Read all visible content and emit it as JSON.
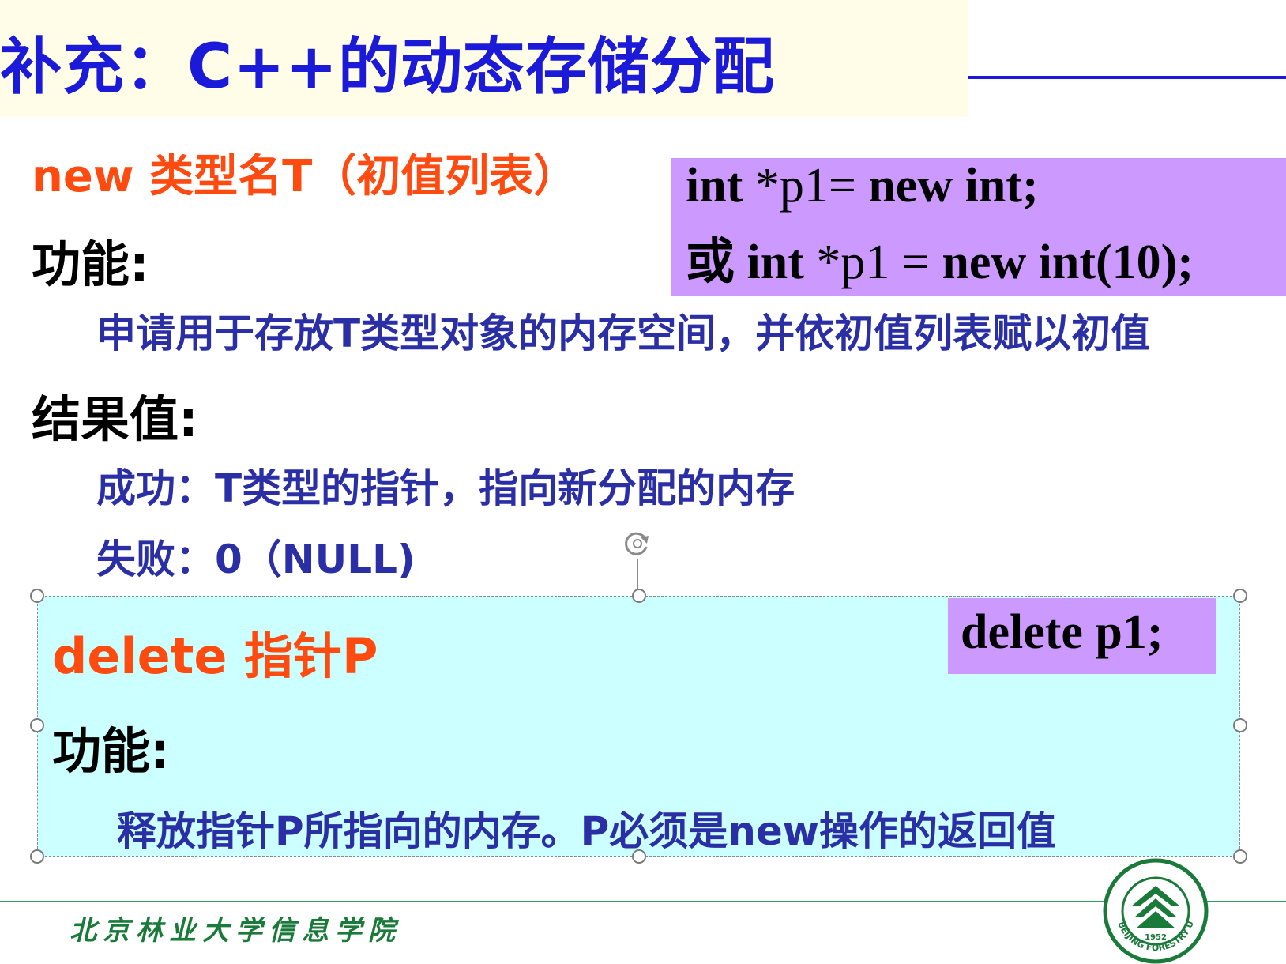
{
  "title": "补充：C++的动态存储分配",
  "new_section": {
    "syntax": "new  类型名T（初值列表）",
    "function_label": "功能:",
    "function_desc": "申请用于存放T类型对象的内存空间，并依初值列表赋以初值",
    "result_label": "结果值:",
    "success": "成功：T类型的指针，指向新分配的内存",
    "failure": "失败：0（NULL)"
  },
  "code_example": {
    "line1": "int *p1= new int;",
    "line2_prefix": "或",
    "line2_a": " int ",
    "line2_b": "*p1 = ",
    "line2_c": "new int(10);"
  },
  "delete_section": {
    "syntax": "delete 指针P",
    "code": "delete p1;",
    "function_label": "功能:",
    "function_desc": "释放指针P所指向的内存。P必须是new操作的返回值"
  },
  "footer": {
    "text": "北京林业大学信息学院",
    "logo_text": "BEIJING FORESTRY UNIVERSITY",
    "logo_year": "1952"
  },
  "colors": {
    "title_blue": "#1a1ad8",
    "syntax_orange": "#ff4a10",
    "desc_blue": "#2b2fa6",
    "code_purple": "#cc99ff",
    "selection_cyan": "#ccffff",
    "footer_green": "#1a7a3a"
  }
}
